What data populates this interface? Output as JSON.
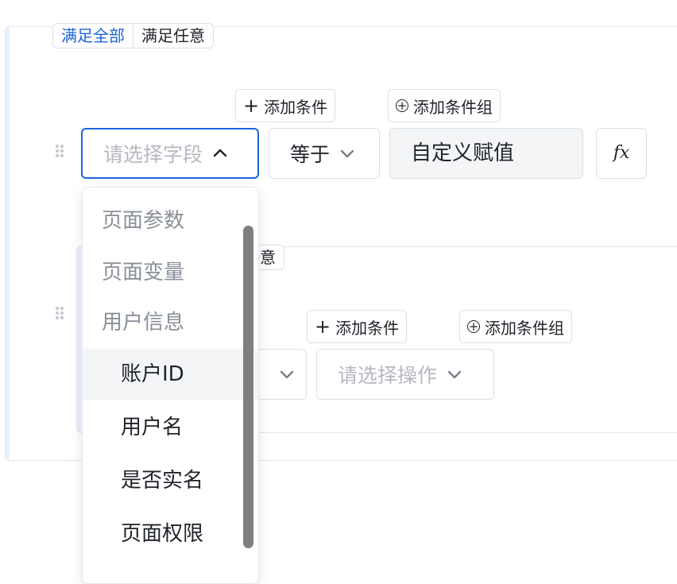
{
  "outer_group": {
    "match_all": "满足全部",
    "match_any": "满足任意",
    "add_condition": "添加条件",
    "add_condition_group": "添加条件组",
    "condition": {
      "field_placeholder": "请选择字段",
      "operator": "等于",
      "value_type": "自定义赋值",
      "fx_label": "fx"
    }
  },
  "inner_group": {
    "match_any": "任意",
    "add_condition": "添加条件",
    "add_condition_group": "添加条件组",
    "operation_placeholder": "请选择操作"
  },
  "dropdown": {
    "group_page_params": "页面参数",
    "group_page_vars": "页面变量",
    "group_user_info": "用户信息",
    "options": [
      "账户ID",
      "用户名",
      "是否实名",
      "页面权限"
    ]
  },
  "colors": {
    "accent": "#1d63d8",
    "border": "#dcdfe6",
    "muted_text": "#8a8f99",
    "placeholder": "#b6b9c0"
  }
}
